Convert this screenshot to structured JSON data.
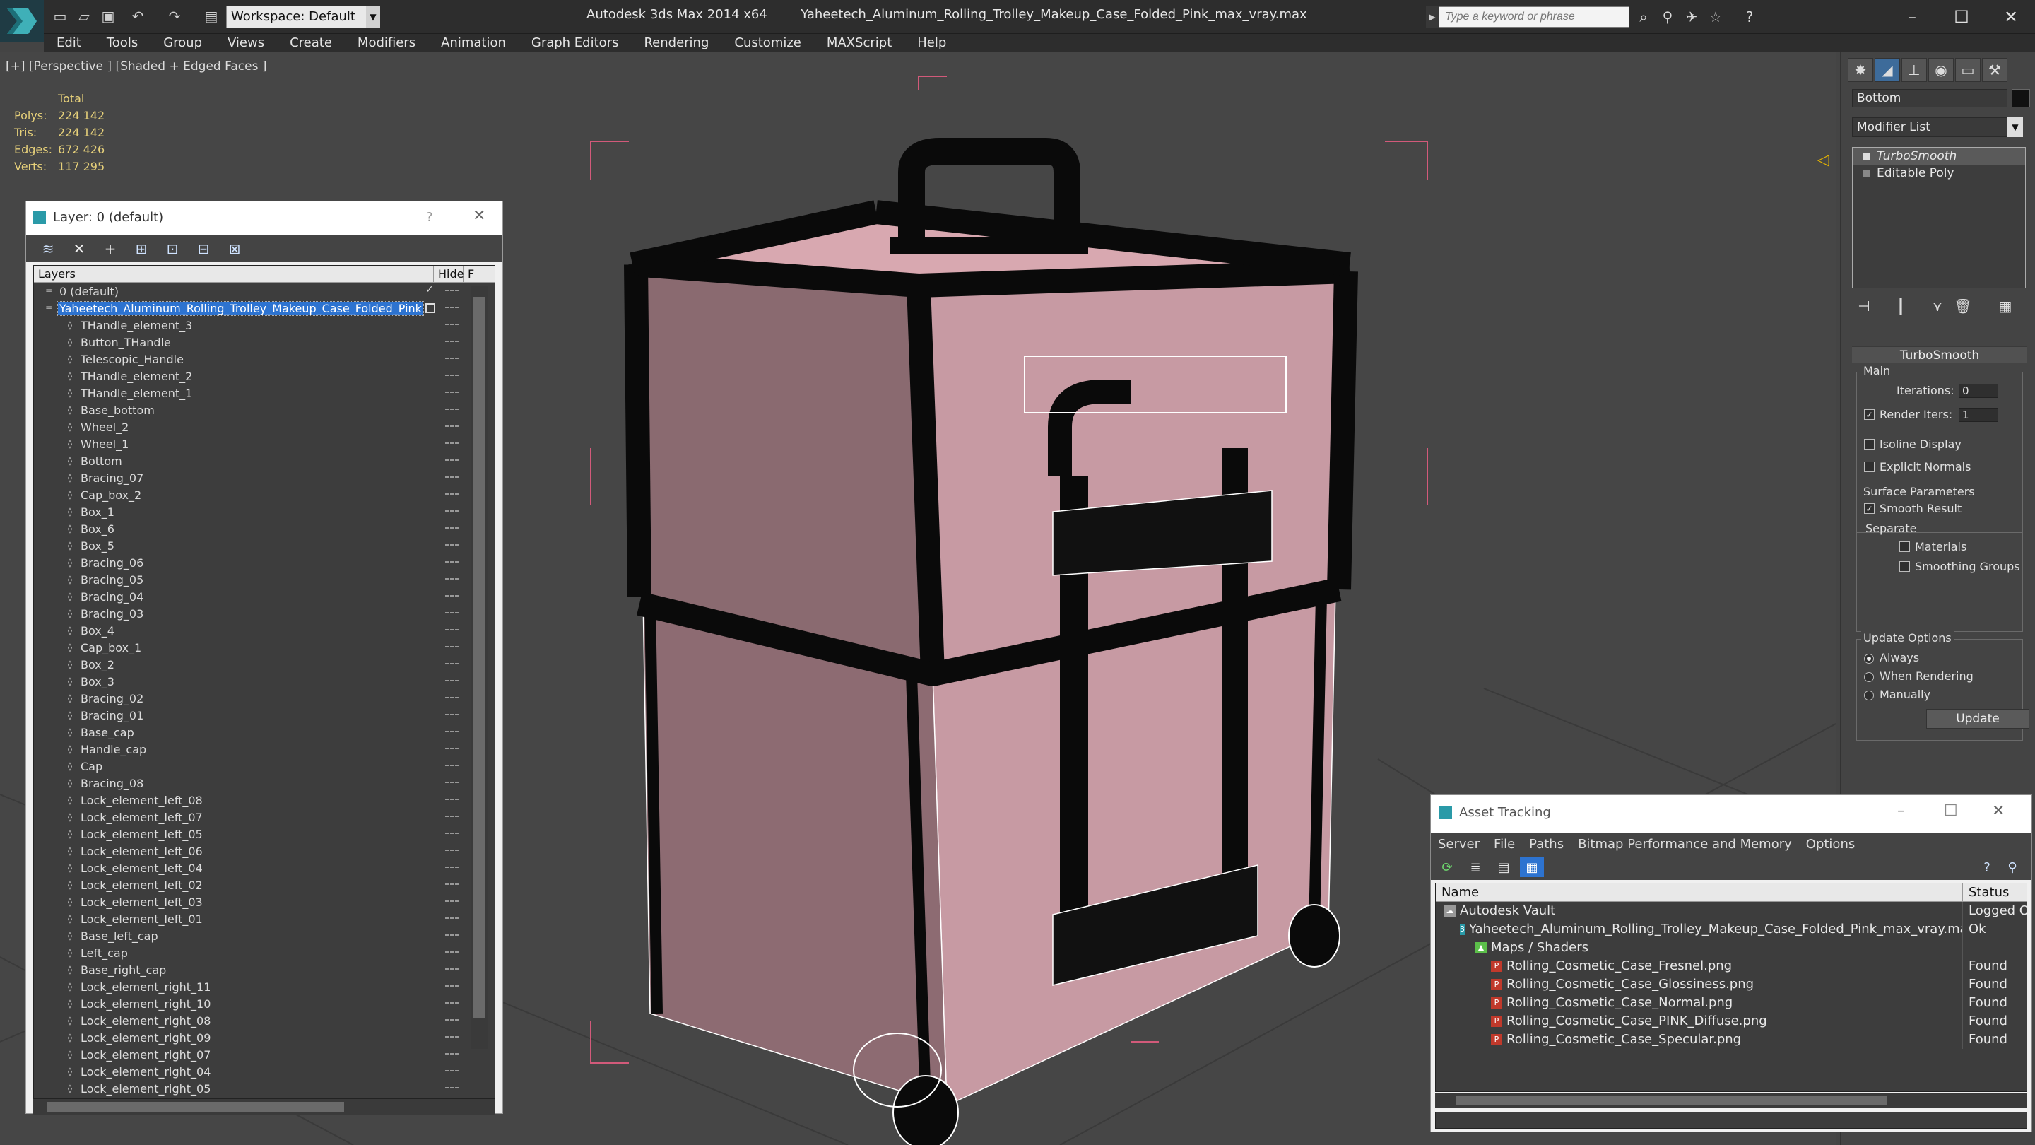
{
  "titlebar": {
    "app_title": "Autodesk 3ds Max  2014 x64",
    "file_title": "Yaheetech_Aluminum_Rolling_Trolley_Makeup_Case_Folded_Pink_max_vray.max",
    "workspace": "Workspace: Default",
    "search_placeholder": "Type a keyword or phrase"
  },
  "menu": [
    "Edit",
    "Tools",
    "Group",
    "Views",
    "Create",
    "Modifiers",
    "Animation",
    "Graph Editors",
    "Rendering",
    "Customize",
    "MAXScript",
    "Help"
  ],
  "viewport": {
    "label": "[+] [Perspective ] [Shaded + Edged Faces ]",
    "stats_header": "Total",
    "stats": [
      {
        "label": "Polys:",
        "value": "224 142"
      },
      {
        "label": "Tris:",
        "value": "224 142"
      },
      {
        "label": "Edges:",
        "value": "672 426"
      },
      {
        "label": "Verts:",
        "value": "117 295"
      }
    ]
  },
  "layer_window": {
    "title": "Layer: 0 (default)",
    "help": "?",
    "col_layers": "Layers",
    "col_hide": "Hide",
    "col_f": "F",
    "rows": [
      {
        "name": "0 (default)",
        "level": 0,
        "checked": true,
        "selected": false
      },
      {
        "name": "Yaheetech_Aluminum_Rolling_Trolley_Makeup_Case_Folded_Pink",
        "level": 0,
        "selected": true
      },
      {
        "name": "THandle_element_3",
        "level": 1
      },
      {
        "name": "Button_THandle",
        "level": 1
      },
      {
        "name": "Telescopic_Handle",
        "level": 1
      },
      {
        "name": "THandle_element_2",
        "level": 1
      },
      {
        "name": "THandle_element_1",
        "level": 1
      },
      {
        "name": "Base_bottom",
        "level": 1
      },
      {
        "name": "Wheel_2",
        "level": 1
      },
      {
        "name": "Wheel_1",
        "level": 1
      },
      {
        "name": "Bottom",
        "level": 1
      },
      {
        "name": "Bracing_07",
        "level": 1
      },
      {
        "name": "Cap_box_2",
        "level": 1
      },
      {
        "name": "Box_1",
        "level": 1
      },
      {
        "name": "Box_6",
        "level": 1
      },
      {
        "name": "Box_5",
        "level": 1
      },
      {
        "name": "Bracing_06",
        "level": 1
      },
      {
        "name": "Bracing_05",
        "level": 1
      },
      {
        "name": "Bracing_04",
        "level": 1
      },
      {
        "name": "Bracing_03",
        "level": 1
      },
      {
        "name": "Box_4",
        "level": 1
      },
      {
        "name": "Cap_box_1",
        "level": 1
      },
      {
        "name": "Box_2",
        "level": 1
      },
      {
        "name": "Box_3",
        "level": 1
      },
      {
        "name": "Bracing_02",
        "level": 1
      },
      {
        "name": "Bracing_01",
        "level": 1
      },
      {
        "name": "Base_cap",
        "level": 1
      },
      {
        "name": "Handle_cap",
        "level": 1
      },
      {
        "name": "Cap",
        "level": 1
      },
      {
        "name": "Bracing_08",
        "level": 1
      },
      {
        "name": "Lock_element_left_08",
        "level": 1
      },
      {
        "name": "Lock_element_left_07",
        "level": 1
      },
      {
        "name": "Lock_element_left_05",
        "level": 1
      },
      {
        "name": "Lock_element_left_06",
        "level": 1
      },
      {
        "name": "Lock_element_left_04",
        "level": 1
      },
      {
        "name": "Lock_element_left_02",
        "level": 1
      },
      {
        "name": "Lock_element_left_03",
        "level": 1
      },
      {
        "name": "Lock_element_left_01",
        "level": 1
      },
      {
        "name": "Base_left_cap",
        "level": 1
      },
      {
        "name": "Left_cap",
        "level": 1
      },
      {
        "name": "Base_right_cap",
        "level": 1
      },
      {
        "name": "Lock_element_right_11",
        "level": 1
      },
      {
        "name": "Lock_element_right_10",
        "level": 1
      },
      {
        "name": "Lock_element_right_08",
        "level": 1
      },
      {
        "name": "Lock_element_right_09",
        "level": 1
      },
      {
        "name": "Lock_element_right_07",
        "level": 1
      },
      {
        "name": "Lock_element_right_04",
        "level": 1
      },
      {
        "name": "Lock_element_right_05",
        "level": 1
      }
    ]
  },
  "command_panel": {
    "object_name": "Bottom",
    "modifier_list": "Modifier List",
    "stack": [
      {
        "name": "TurboSmooth",
        "selected": true
      },
      {
        "name": "Editable Poly",
        "selected": false
      }
    ],
    "rollout_title": "TurboSmooth",
    "main_group": "Main",
    "iterations_label": "Iterations:",
    "iterations_value": "0",
    "render_iters_label": "Render Iters:",
    "render_iters_value": "1",
    "isoline_label": "Isoline Display",
    "explicit_normals_label": "Explicit Normals",
    "surface_group": "Surface Parameters",
    "smooth_result_label": "Smooth Result",
    "separate_label": "Separate",
    "materials_label": "Materials",
    "smoothing_groups_label": "Smoothing Groups",
    "update_group": "Update Options",
    "always_label": "Always",
    "when_rendering_label": "When Rendering",
    "manually_label": "Manually",
    "update_button": "Update"
  },
  "asset_tracking": {
    "title": "Asset Tracking",
    "menus": [
      "Server",
      "File",
      "Paths",
      "Bitmap Performance and Memory",
      "Options"
    ],
    "col_name": "Name",
    "col_status": "Status",
    "rows": [
      {
        "name": "Autodesk Vault",
        "status": "Logged Ou",
        "level": 0,
        "icon": "vault"
      },
      {
        "name": "Yaheetech_Aluminum_Rolling_Trolley_Makeup_Case_Folded_Pink_max_vray.max",
        "status": "Ok",
        "level": 1,
        "icon": "max"
      },
      {
        "name": "Maps / Shaders",
        "status": "",
        "level": 2,
        "icon": "maps"
      },
      {
        "name": "Rolling_Cosmetic_Case_Fresnel.png",
        "status": "Found",
        "level": 3,
        "icon": "png"
      },
      {
        "name": "Rolling_Cosmetic_Case_Glossiness.png",
        "status": "Found",
        "level": 3,
        "icon": "png"
      },
      {
        "name": "Rolling_Cosmetic_Case_Normal.png",
        "status": "Found",
        "level": 3,
        "icon": "png"
      },
      {
        "name": "Rolling_Cosmetic_Case_PINK_Diffuse.png",
        "status": "Found",
        "level": 3,
        "icon": "png"
      },
      {
        "name": "Rolling_Cosmetic_Case_Specular.png",
        "status": "Found",
        "level": 3,
        "icon": "png"
      }
    ]
  },
  "colors": {
    "case_pink": "#c79aa3",
    "case_frame": "#0a0a0a",
    "bbox_pink": "#d25a7a",
    "selection_blue": "#2d73d0",
    "stats_yellow": "#e6d07a"
  }
}
